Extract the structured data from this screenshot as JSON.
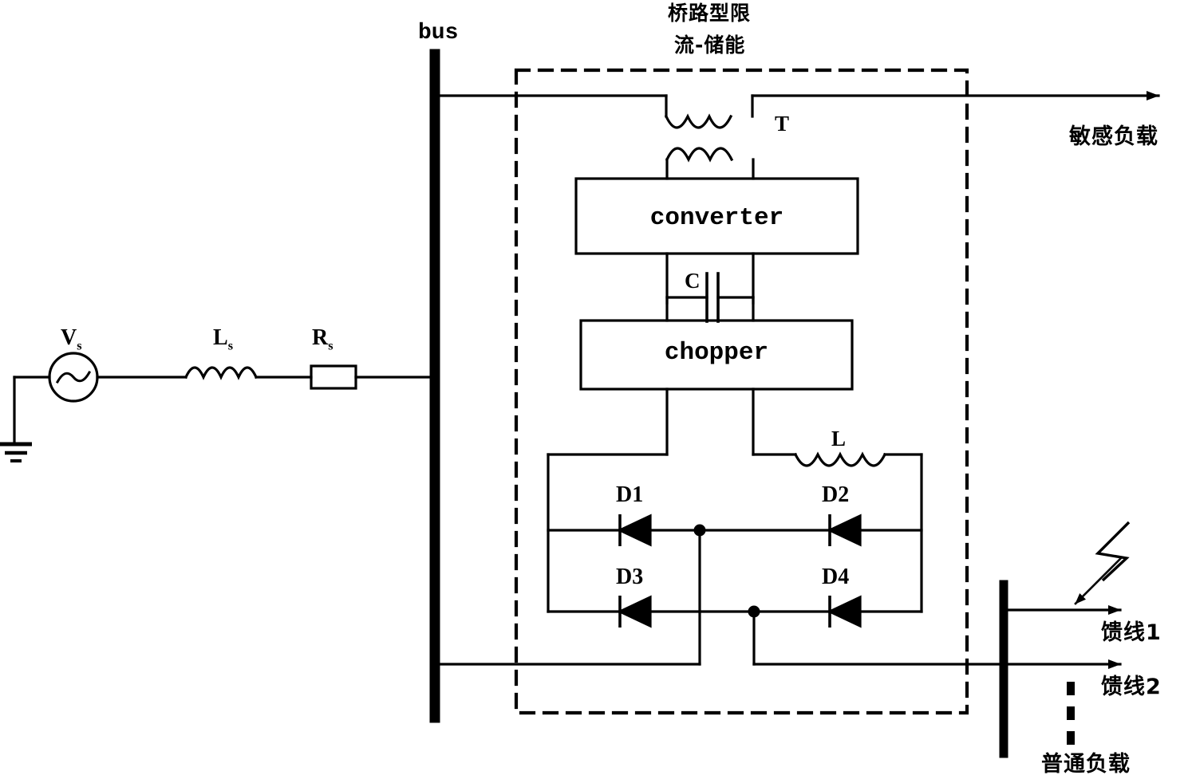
{
  "figure": {
    "type": "circuit-schematic",
    "title_block": {
      "line1": "桥路型限",
      "line2": "流-储能"
    }
  },
  "labels": {
    "bus": "bus",
    "source_voltage": "V",
    "source_voltage_sub": "s",
    "source_inductor": "L",
    "source_inductor_sub": "s",
    "source_resistor": "R",
    "source_resistor_sub": "s",
    "transformer": "T",
    "converter": "converter",
    "chopper": "chopper",
    "capacitor": "C",
    "bridge_inductor": "L",
    "diode_1": "D1",
    "diode_2": "D2",
    "diode_3": "D3",
    "diode_4": "D4",
    "sensitive_load": "敏感负载",
    "feeder_1": "馈线1",
    "feeder_2": "馈线2",
    "normal_load": "普通负载"
  },
  "components": [
    {
      "id": "vs",
      "kind": "ac-voltage-source",
      "label": "Vs"
    },
    {
      "id": "ground",
      "kind": "earth-ground",
      "label": ""
    },
    {
      "id": "ls",
      "kind": "inductor",
      "label": "Ls"
    },
    {
      "id": "rs",
      "kind": "resistor",
      "label": "Rs"
    },
    {
      "id": "busbar",
      "kind": "busbar",
      "label": "bus"
    },
    {
      "id": "t",
      "kind": "transformer",
      "label": "T"
    },
    {
      "id": "converter",
      "kind": "block",
      "label": "converter"
    },
    {
      "id": "c",
      "kind": "capacitor",
      "label": "C"
    },
    {
      "id": "chopper",
      "kind": "block",
      "label": "chopper"
    },
    {
      "id": "l",
      "kind": "inductor",
      "label": "L"
    },
    {
      "id": "d1",
      "kind": "diode",
      "label": "D1"
    },
    {
      "id": "d2",
      "kind": "diode",
      "label": "D2"
    },
    {
      "id": "d3",
      "kind": "diode",
      "label": "D3"
    },
    {
      "id": "d4",
      "kind": "diode",
      "label": "D4"
    },
    {
      "id": "feederbus",
      "kind": "busbar",
      "label": ""
    },
    {
      "id": "fault",
      "kind": "lightning-fault",
      "label": ""
    }
  ],
  "colors": {
    "line": "#000000",
    "background": "#ffffff",
    "text": "#000000"
  }
}
